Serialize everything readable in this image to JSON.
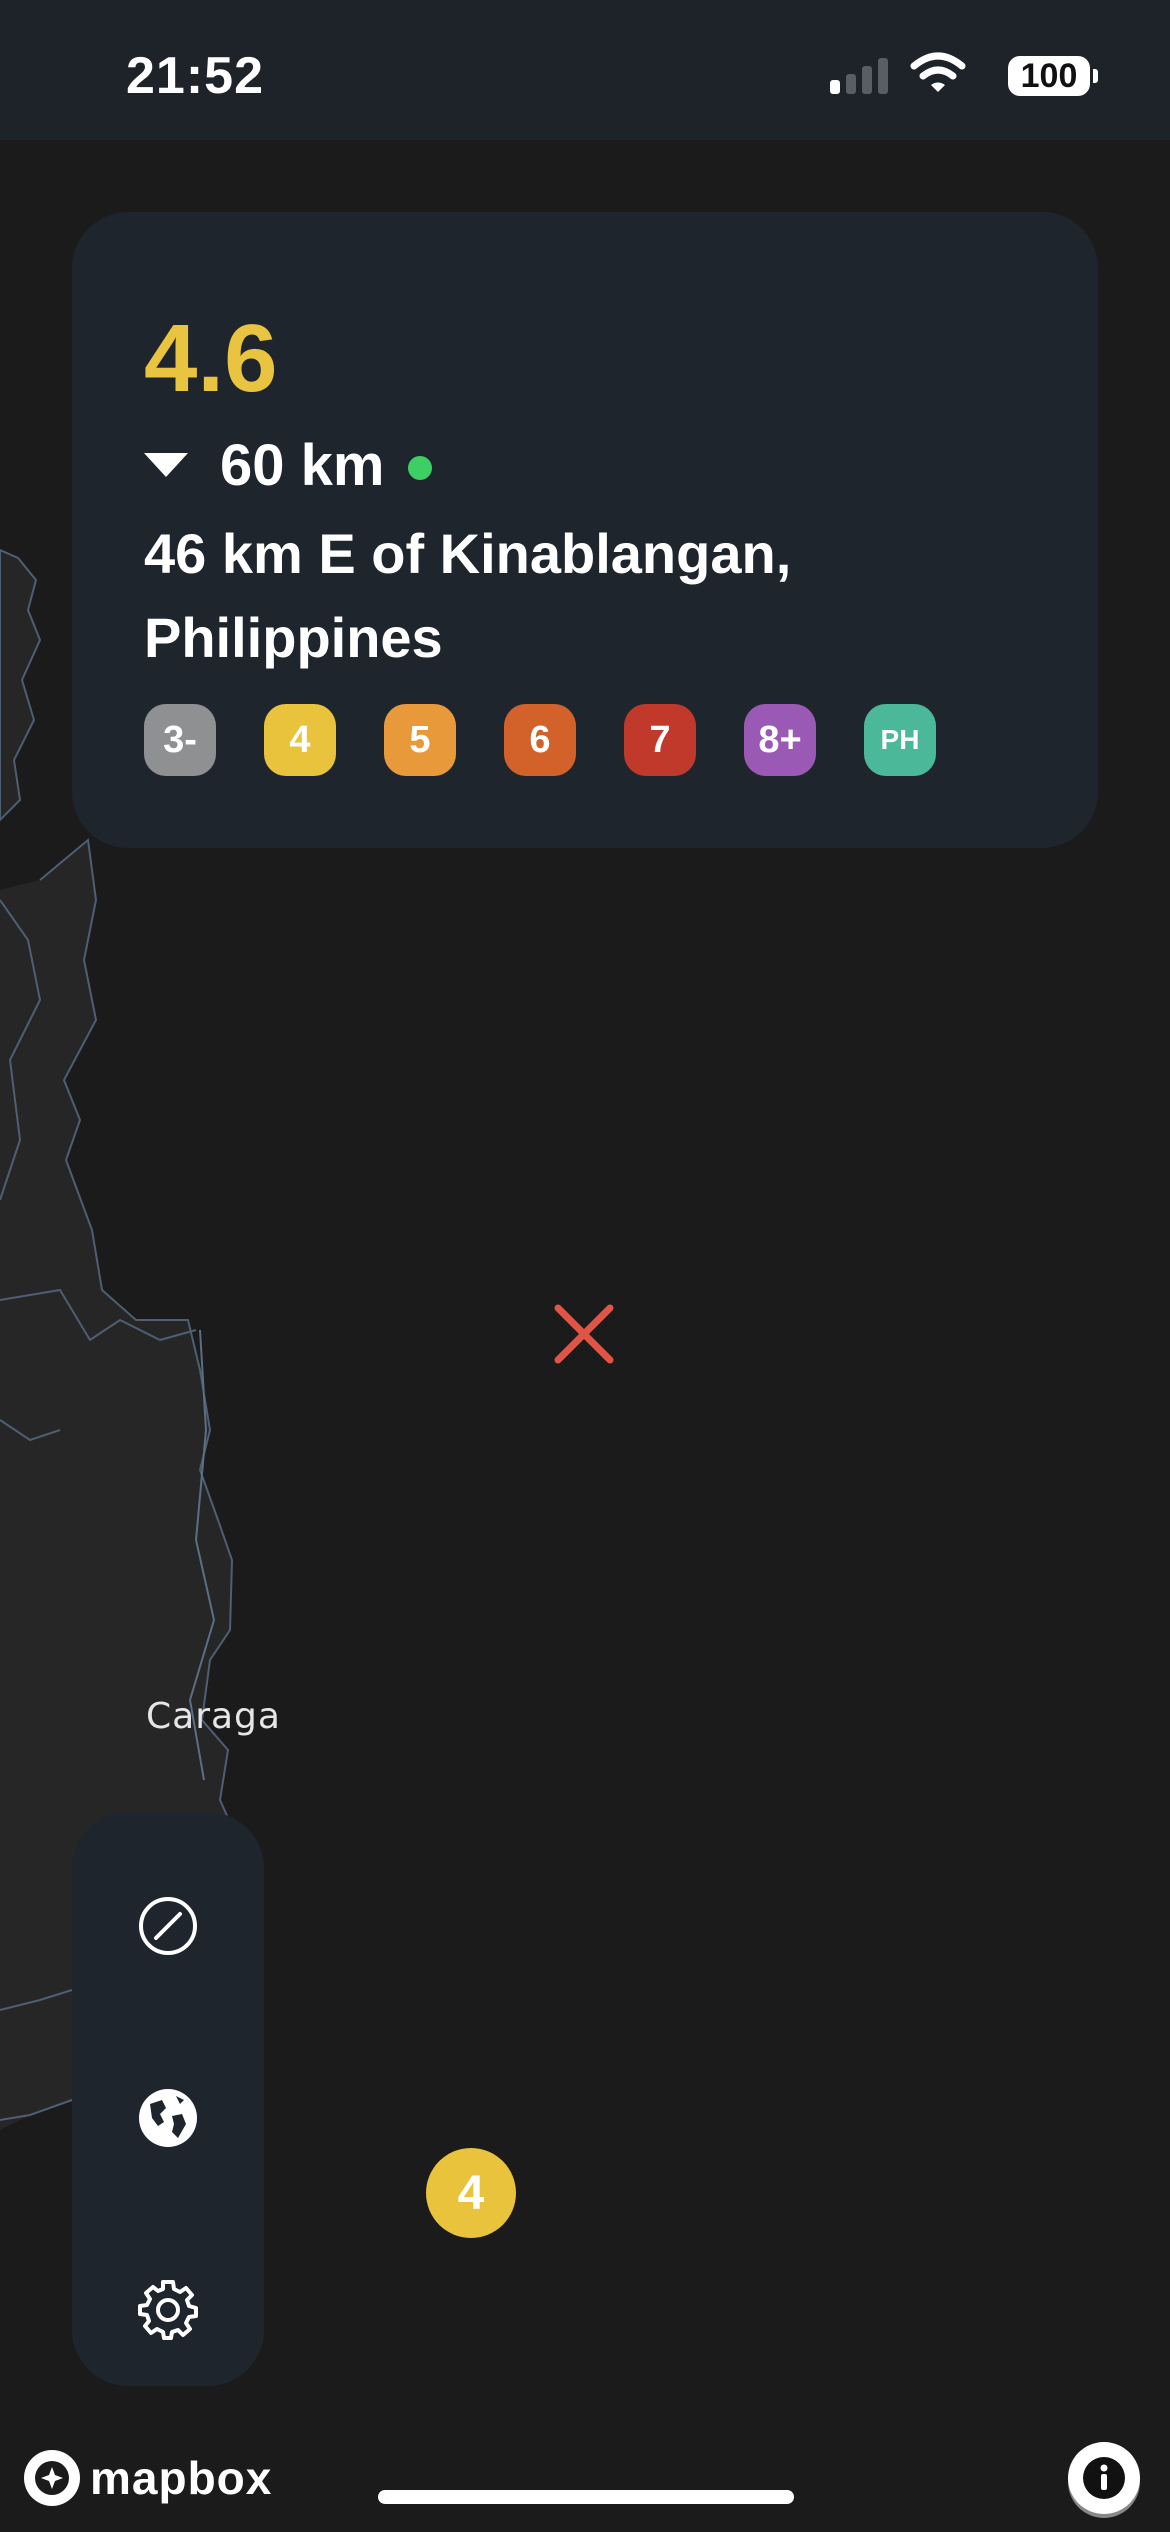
{
  "status_bar": {
    "time": "21:52",
    "battery": "100",
    "signal_bars_active": 1,
    "signal_bars_total": 4,
    "wifi_icon": "wifi-icon"
  },
  "earthquake": {
    "magnitude": "4.6",
    "depth": "60 km",
    "place": "46 km E of Kinablangan, Philippines",
    "magnitude_color": "#e9c440",
    "live_indicator_color": "#3ccf63"
  },
  "filters": [
    {
      "label": "3-",
      "color": "#8e9092"
    },
    {
      "label": "4",
      "color": "#e8c33b"
    },
    {
      "label": "5",
      "color": "#e89a3a"
    },
    {
      "label": "6",
      "color": "#d3622a"
    },
    {
      "label": "7",
      "color": "#c0392b"
    },
    {
      "label": "8+",
      "color": "#9b59b6"
    },
    {
      "label": "PH",
      "color": "#4cb89a"
    }
  ],
  "map": {
    "region_label": "Caraga",
    "epicenter_marker_icon": "x-marker-icon",
    "epicenter_color": "#e05545",
    "cluster_count": "4",
    "cluster_color": "#e8c33b",
    "attribution": "mapbox"
  },
  "toolbar": {
    "items": [
      {
        "icon": "no-filter-icon"
      },
      {
        "icon": "globe-icon"
      },
      {
        "icon": "gear-icon"
      }
    ]
  },
  "info_button_icon": "info-icon"
}
